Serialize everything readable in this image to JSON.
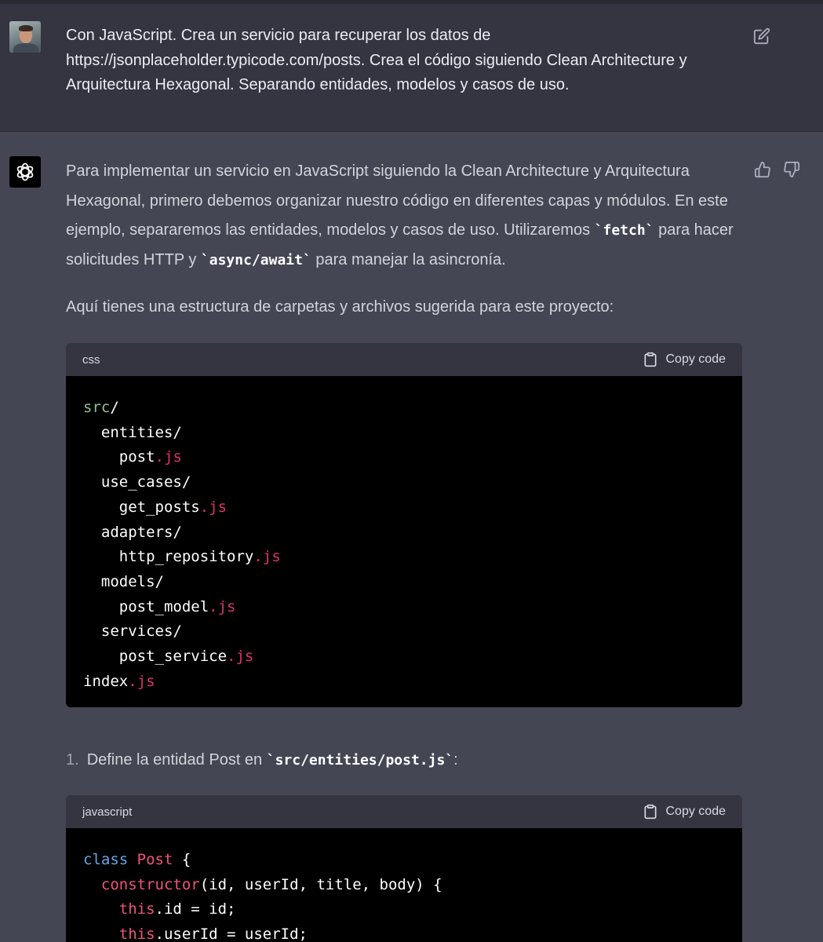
{
  "user": {
    "message": "Con JavaScript. Crea un servicio para recuperar los datos de https://jsonplaceholder.typicode.com/posts. Crea el código siguiendo Clean Architecture y Arquitectura Hexagonal. Separando entidades, modelos y casos de uso.",
    "edit_icon": "edit-icon"
  },
  "assistant": {
    "para1_a": "Para implementar un servicio en JavaScript siguiendo la Clean Architecture y Arquitectura Hexagonal, primero debemos organizar nuestro código en diferentes capas y módulos. En este ejemplo, separaremos las entidades, modelos y casos de uso. Utilizaremos ",
    "para1_code1": "`fetch`",
    "para1_b": " para hacer solicitudes HTTP y ",
    "para1_code2": "`async/await`",
    "para1_c": " para manejar la asincronía.",
    "para2": "Aquí tienes una estructura de carpetas y archivos sugerida para este proyecto:",
    "step1_num": "1.",
    "step1_a": "Define la entidad Post en ",
    "step1_code": "`src/entities/post.js`",
    "step1_b": ":"
  },
  "codeblock1": {
    "lang": "css",
    "copy_label": "Copy code",
    "lines": {
      "l1": "src",
      "l1s": "/",
      "l2": "  entities/",
      "l3": "    post",
      "l3e": ".js",
      "l4": "  use_cases/",
      "l5": "    get_posts",
      "l5e": ".js",
      "l6": "  adapters/",
      "l7": "    http_repository",
      "l7e": ".js",
      "l8": "  models/",
      "l9": "    post_model",
      "l9e": ".js",
      "l10": "  services/",
      "l11": "    post_service",
      "l11e": ".js",
      "l12": "index",
      "l12e": ".js"
    }
  },
  "codeblock2": {
    "lang": "javascript",
    "copy_label": "Copy code",
    "lines": {
      "l1_kw": "class",
      "l1_cls": "Post",
      "l1_rest": " {",
      "l2_fn": "constructor",
      "l2_rest": "(id, userId, title, body) {",
      "l3_this": "this",
      "l3_rest": ".id = id;",
      "l4_this": "this",
      "l4_rest": ".userId = userId;"
    }
  },
  "colors": {
    "page_bg": "#444654",
    "user_bg": "#343541",
    "code_bg": "#000000",
    "code_header_bg": "#343541",
    "syntax_green": "#8bc490",
    "syntax_red": "#e0306a",
    "syntax_keyword": "#63a7e8"
  }
}
